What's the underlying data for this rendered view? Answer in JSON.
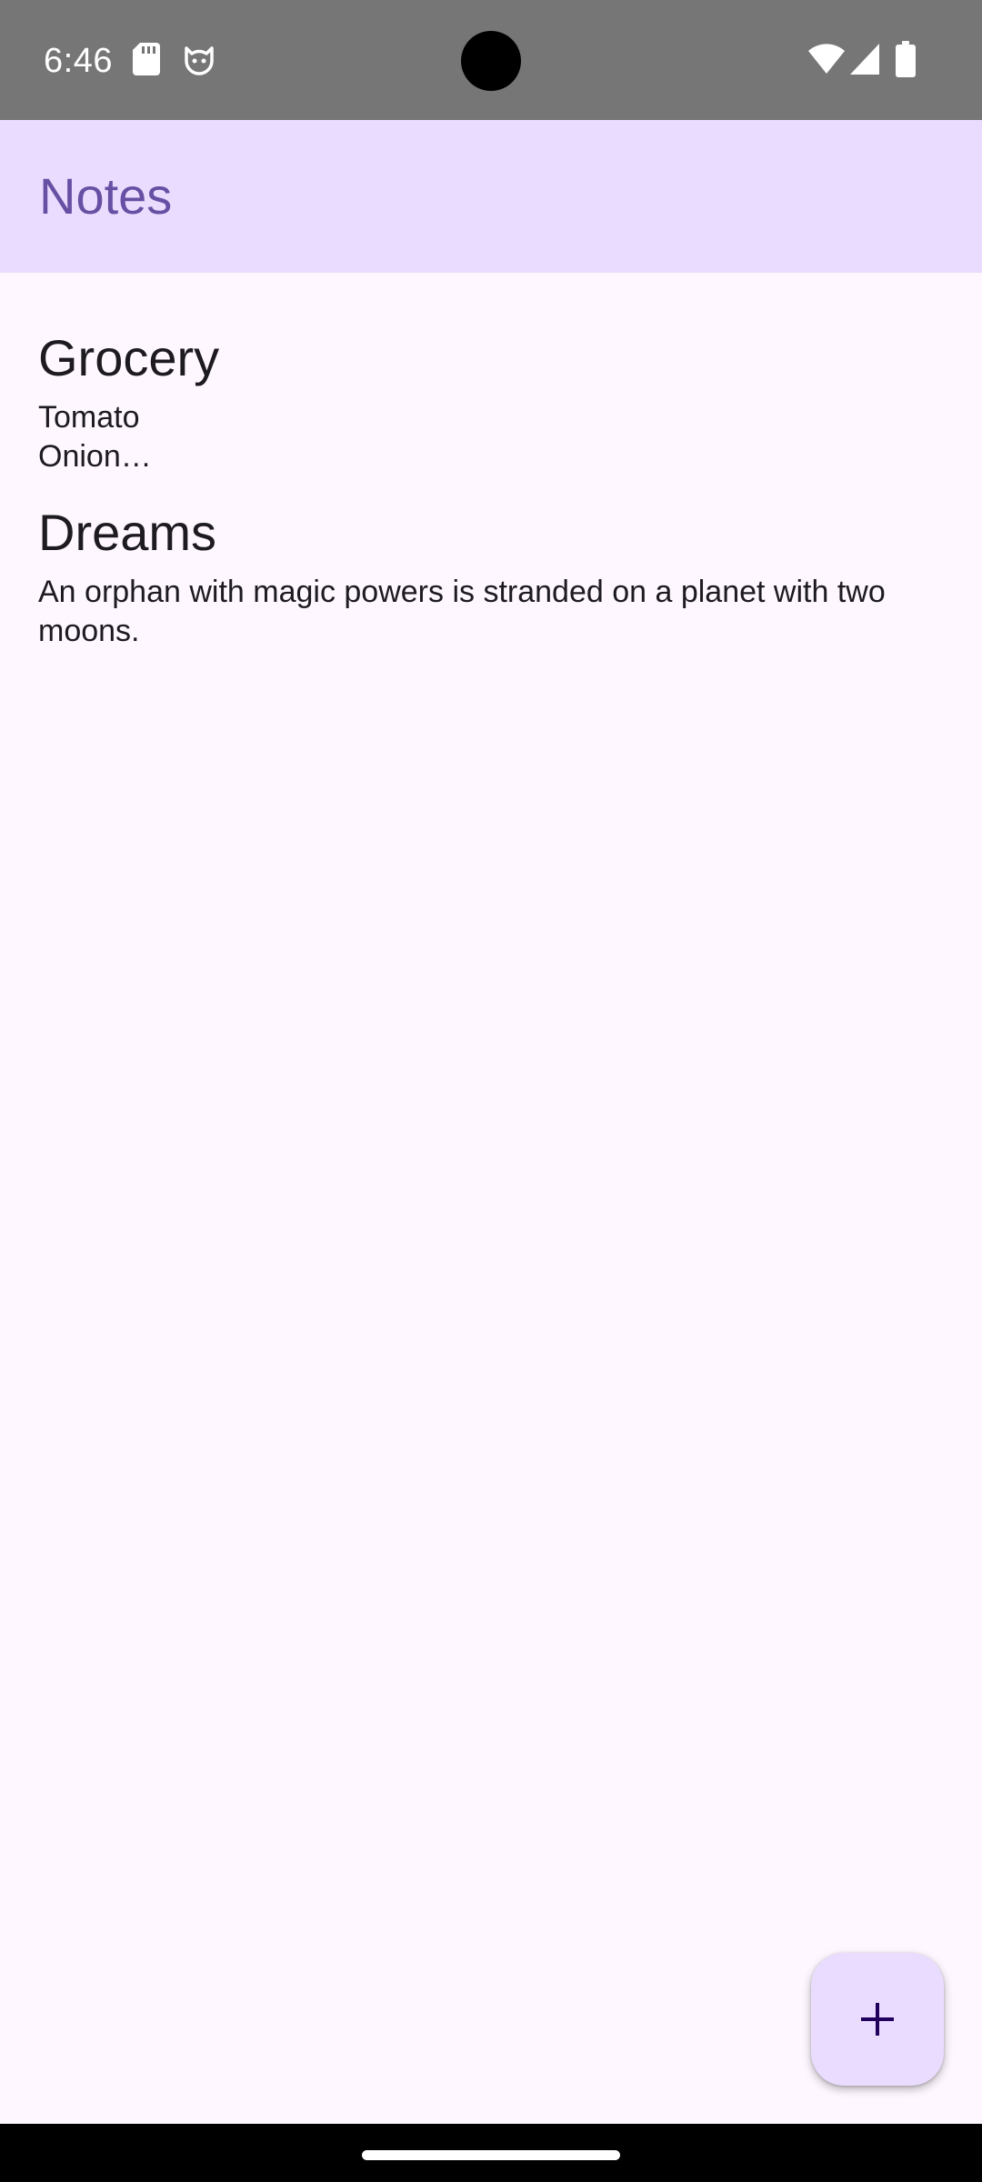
{
  "status_bar": {
    "time": "6:46",
    "icons": [
      "sd-card-icon",
      "cat-notification-icon",
      "wifi-icon",
      "cell-signal-icon",
      "battery-icon"
    ]
  },
  "app_bar": {
    "title": "Notes"
  },
  "notes": [
    {
      "title": "Grocery",
      "body": "Tomato\nOnion…"
    },
    {
      "title": "Dreams",
      "body": "An orphan with magic powers is stranded on a planet with two moons."
    }
  ],
  "fab": {
    "icon": "plus-icon"
  },
  "colors": {
    "status_bar_bg": "#767676",
    "app_bar_bg": "#eadcfe",
    "title_color": "#6750a4",
    "background": "#fef7ff",
    "fab_bg": "#eadcfe",
    "fab_icon": "#21005d",
    "text": "#1d1b20"
  }
}
